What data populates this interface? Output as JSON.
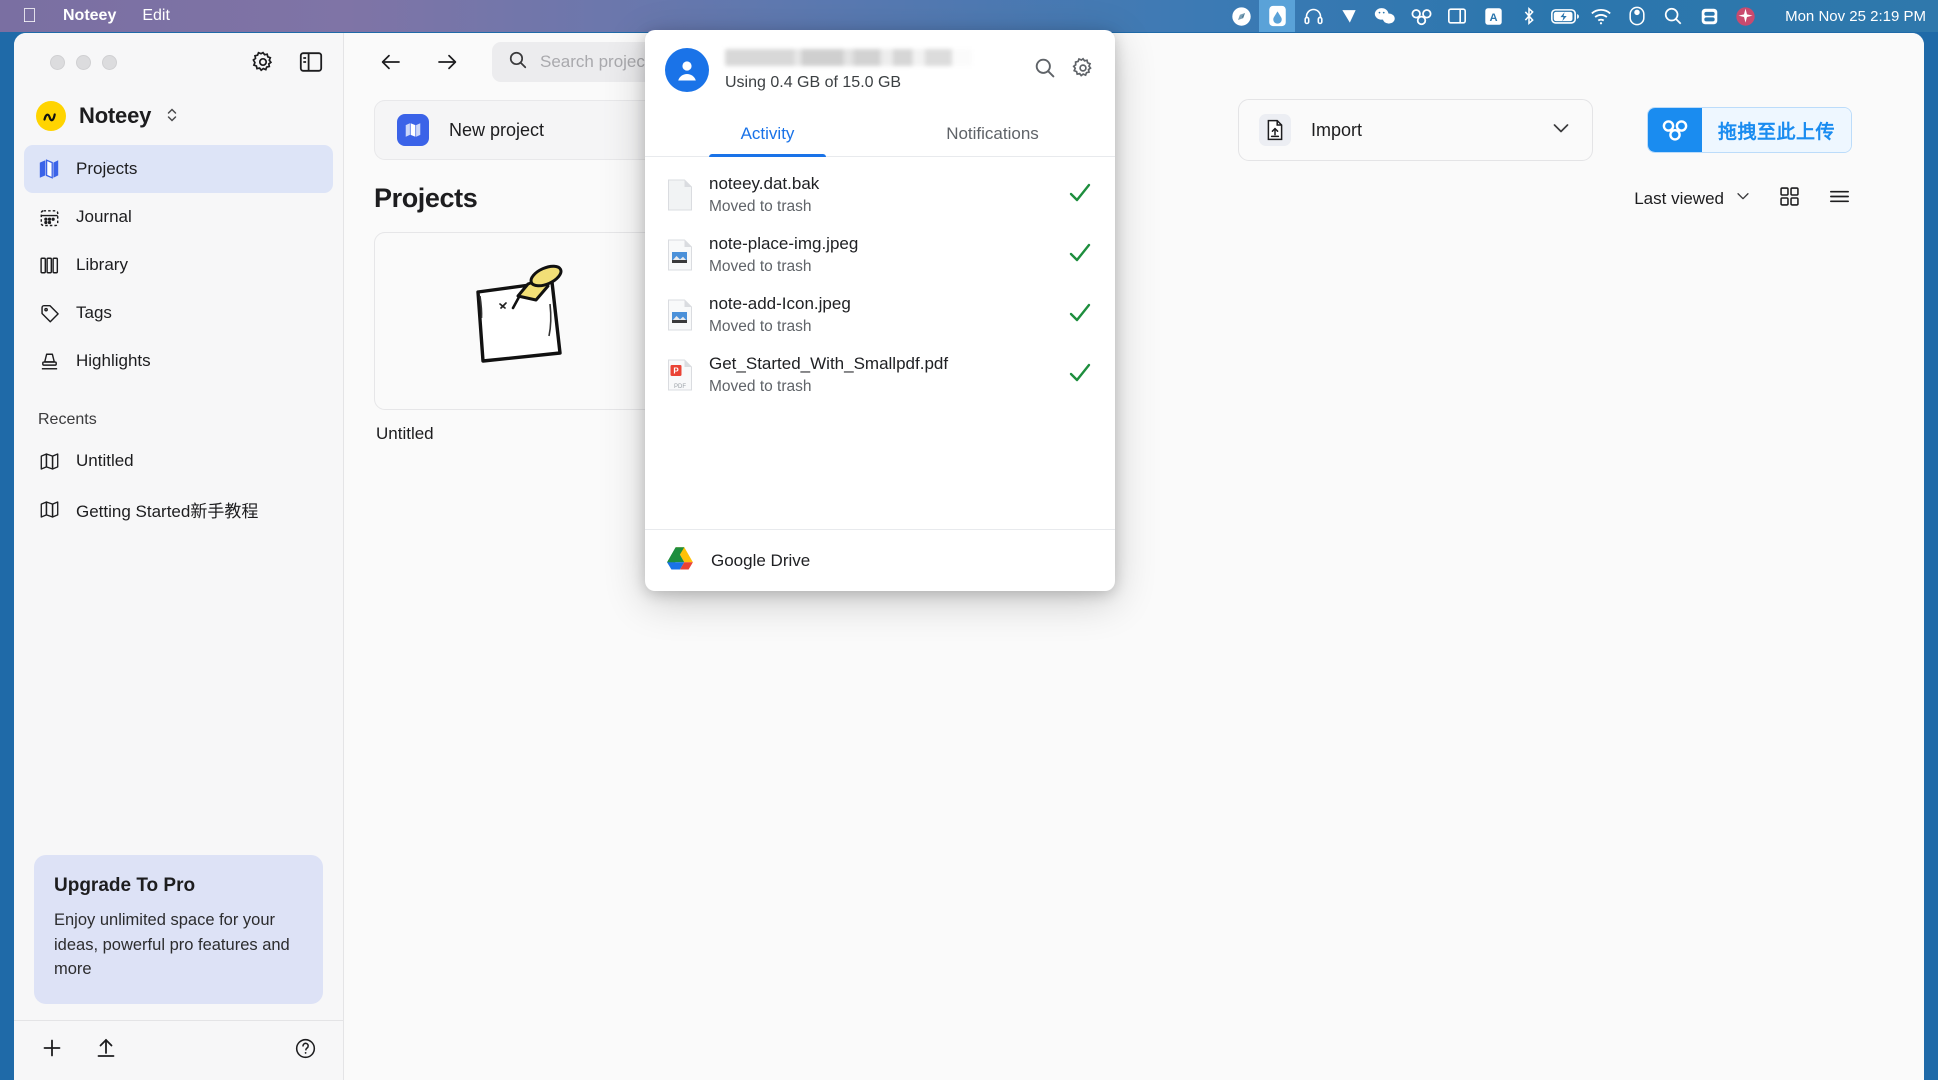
{
  "menubar": {
    "apple_icon": "apple-icon",
    "app_name": "Noteey",
    "edit_menu": "Edit",
    "tray_icons": [
      "safari-icon",
      "drive-icon",
      "headphone-icon",
      "eagle-icon",
      "wechat-icon",
      "baidu-netdisk-icon",
      "window-icon",
      "input-source-icon",
      "bluetooth-icon",
      "battery-charging-icon",
      "wifi-icon",
      "control-center-icon",
      "spotlight-icon",
      "siri-icon",
      "notification-icon"
    ],
    "active_tray_icon": "drive-icon",
    "clock": "Mon Nov 25  2:19 PM"
  },
  "sidebar": {
    "window_controls": [
      "close",
      "minimize",
      "zoom"
    ],
    "settings_icon": "gear-icon",
    "panel_toggle_icon": "sidebar-toggle-icon",
    "brand": {
      "name": "Noteey",
      "logo_icon": "noteey-logo-icon",
      "chevron_icon": "chevron-updown-icon",
      "logo_color": "#ffd400"
    },
    "items": [
      {
        "label": "Projects",
        "icon": "map-icon",
        "active": true
      },
      {
        "label": "Journal",
        "icon": "calendar-icon",
        "active": false
      },
      {
        "label": "Library",
        "icon": "books-icon",
        "active": false
      },
      {
        "label": "Tags",
        "icon": "tag-icon",
        "active": false
      },
      {
        "label": "Highlights",
        "icon": "highlight-icon",
        "active": false
      }
    ],
    "recents_label": "Recents",
    "recents": [
      {
        "label": "Untitled",
        "icon": "map-icon"
      },
      {
        "label": "Getting Started新手教程",
        "icon": "map-icon"
      }
    ],
    "promo": {
      "title": "Upgrade To Pro",
      "body": "Enjoy unlimited space for your ideas, powerful pro features and more",
      "background": "#dde2f6"
    },
    "bottom": {
      "add_icon": "plus-icon",
      "upload_icon": "upload-icon",
      "help_icon": "help-circle-icon"
    }
  },
  "main": {
    "nav": {
      "back_icon": "arrow-left-icon",
      "forward_icon": "arrow-right-icon"
    },
    "search": {
      "placeholder": "Search projects",
      "value": "",
      "icon": "search-icon"
    },
    "new_project": {
      "label": "New project",
      "icon": "map-icon",
      "accent": "#3b63e8"
    },
    "import": {
      "label": "Import",
      "icon": "upload-file-icon",
      "chevron_icon": "chevron-down-icon"
    },
    "baidu_upload": {
      "label": "拖拽至此上传",
      "icon": "baidu-netdisk-icon",
      "accent": "#1a8cf0"
    },
    "section": {
      "title": "Projects",
      "sort_label": "Last viewed",
      "sort_chevron_icon": "chevron-down-icon",
      "grid_view_icon": "grid-view-icon",
      "list_view_icon": "list-view-icon"
    },
    "projects": [
      {
        "title": "Untitled",
        "thumb_icon": "pinned-note-illustration"
      }
    ]
  },
  "google_drive_popup": {
    "account": {
      "avatar_icon": "account-avatar-icon",
      "name_redacted": true
    },
    "storage": "Using 0.4 GB of 15.0 GB",
    "search_icon": "search-icon",
    "settings_icon": "gear-icon",
    "tabs": [
      {
        "label": "Activity",
        "active": true
      },
      {
        "label": "Notifications",
        "active": false
      }
    ],
    "files": [
      {
        "name": "noteey.dat.bak",
        "status": "Moved to trash",
        "icon": "generic-file-icon",
        "check_icon": "check-icon"
      },
      {
        "name": "note-place-img.jpeg",
        "status": "Moved to trash",
        "icon": "image-file-icon",
        "check_icon": "check-icon"
      },
      {
        "name": "note-add-Icon.jpeg",
        "status": "Moved to trash",
        "icon": "image-file-icon",
        "check_icon": "check-icon"
      },
      {
        "name": "Get_Started_With_Smallpdf.pdf",
        "status": "Moved to trash",
        "icon": "pdf-file-icon",
        "check_icon": "check-icon"
      }
    ],
    "footer": {
      "label": "Google Drive",
      "icon": "google-drive-icon"
    }
  }
}
